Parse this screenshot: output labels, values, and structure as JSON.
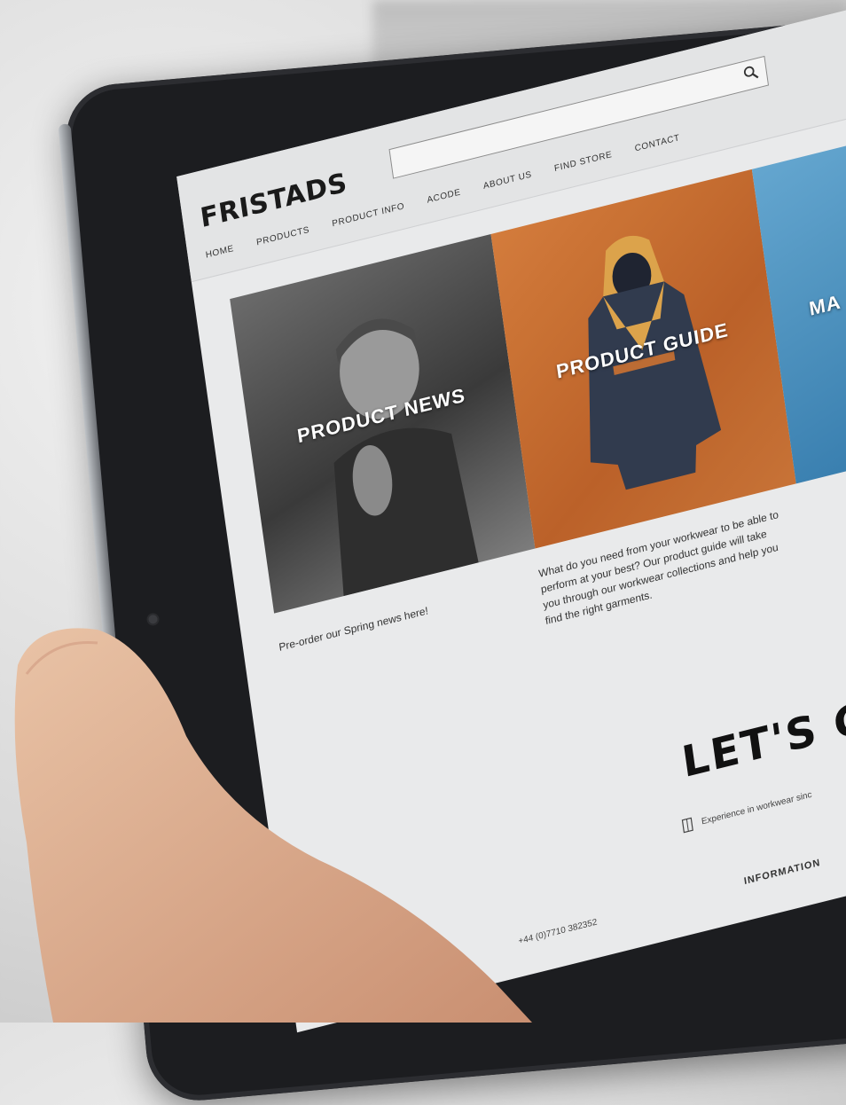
{
  "site": {
    "logo": "FRISTADS",
    "nav": [
      "HOME",
      "PRODUCTS",
      "PRODUCT INFO",
      "ACODE",
      "ABOUT US",
      "FIND STORE",
      "CONTACT"
    ],
    "search_placeholder": ""
  },
  "tiles": {
    "news_label": "PRODUCT NEWS",
    "guide_label": "PRODUCT GUIDE",
    "partial_label": "MA"
  },
  "captions": {
    "news": "Pre-order our Spring news here!",
    "guide": "What do you need from your workwear to be able to perform at your best? Our product guide will take you through our workwear collections and help you find the right garments."
  },
  "footer": {
    "headline": "LET'S G",
    "experience": "Experience in workwear sinc",
    "phone": "+44 (0)7710 382352",
    "information": "INFORMATION"
  },
  "colors": {
    "guide_tile": "#d4712a",
    "more_tile": "#2d7fb8",
    "screen": "#e9eaeb",
    "bezel": "#1c1d20"
  }
}
